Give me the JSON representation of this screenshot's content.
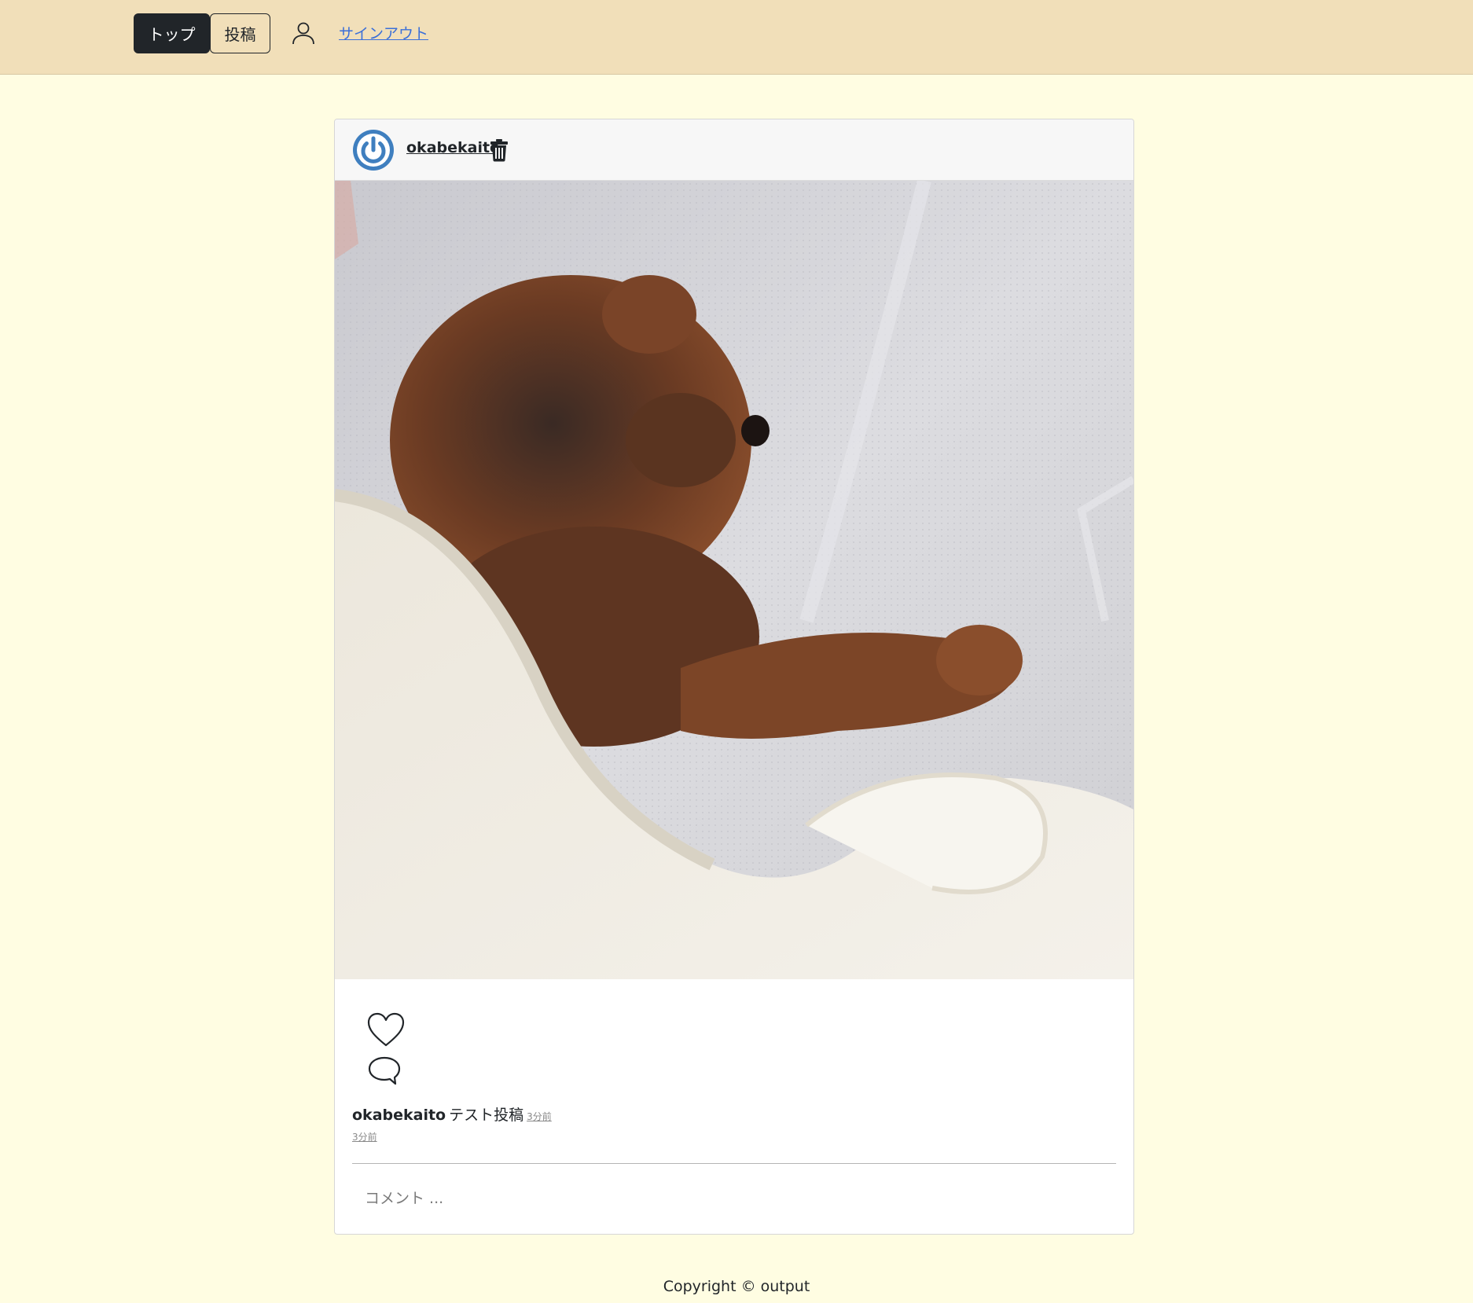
{
  "navbar": {
    "top_label": "トップ",
    "post_label": "投稿",
    "profile_icon": "user-icon",
    "signout_label": "サインアウト"
  },
  "post": {
    "username": "okabekaito",
    "avatar_icon": "power-icon",
    "delete_icon": "trash-icon",
    "image_description_icon": "photo",
    "like_icon": "heart-icon",
    "comment_icon": "speech-bubble-icon",
    "caption_user": "okabekaito",
    "caption_text": "テスト投稿",
    "caption_time": "3分前",
    "time": "3分前",
    "comment_placeholder": "コメント ..."
  },
  "footer": {
    "copyright": "Copyright © output"
  },
  "colors": {
    "navbar_bg": "#f1dfb9",
    "page_bg": "#fffde2",
    "avatar_blue": "#3f7fbf",
    "link_blue": "#3b6fd8"
  }
}
